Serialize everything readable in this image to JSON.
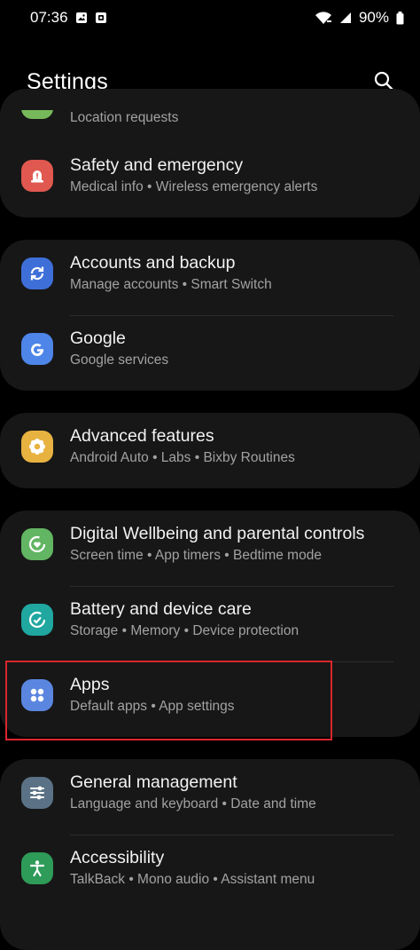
{
  "status_bar": {
    "time": "07:36",
    "battery": "90%"
  },
  "header": {
    "title": "Settings"
  },
  "partial_item": {
    "subtitle": "Location requests"
  },
  "groups": [
    {
      "items": [
        {
          "title": "Safety and emergency",
          "subtitle": "Medical info  •  Wireless emergency alerts",
          "icon": "warning-siren-icon",
          "color": "#e0584f"
        }
      ]
    },
    {
      "items": [
        {
          "title": "Accounts and backup",
          "subtitle": "Manage accounts  •  Smart Switch",
          "icon": "sync-icon",
          "color": "#3e6fd8"
        },
        {
          "title": "Google",
          "subtitle": "Google services",
          "icon": "google-g-icon",
          "color": "#4d85e8"
        }
      ]
    },
    {
      "items": [
        {
          "title": "Advanced features",
          "subtitle": "Android Auto  •  Labs  •  Bixby Routines",
          "icon": "gear-flower-icon",
          "color": "#e8b241"
        }
      ]
    },
    {
      "items": [
        {
          "title": "Digital Wellbeing and parental controls",
          "subtitle": "Screen time  •  App timers  •  Bedtime mode",
          "icon": "wellbeing-heart-icon",
          "color": "#62b563"
        },
        {
          "title": "Battery and device care",
          "subtitle": "Storage  •  Memory  •  Device protection",
          "icon": "device-care-icon",
          "color": "#1fa7a0"
        },
        {
          "title": "Apps",
          "subtitle": "Default apps  •  App settings",
          "icon": "apps-grid-icon",
          "color": "#5b86e0"
        }
      ]
    },
    {
      "items": [
        {
          "title": "General management",
          "subtitle": "Language and keyboard  •  Date and time",
          "icon": "sliders-icon",
          "color": "#5b7286"
        },
        {
          "title": "Accessibility",
          "subtitle": "TalkBack  •  Mono audio  •  Assistant menu",
          "icon": "accessibility-icon",
          "color": "#2e9b58"
        }
      ]
    }
  ],
  "highlighted_item": "Apps",
  "highlight_color": "#d9262c"
}
